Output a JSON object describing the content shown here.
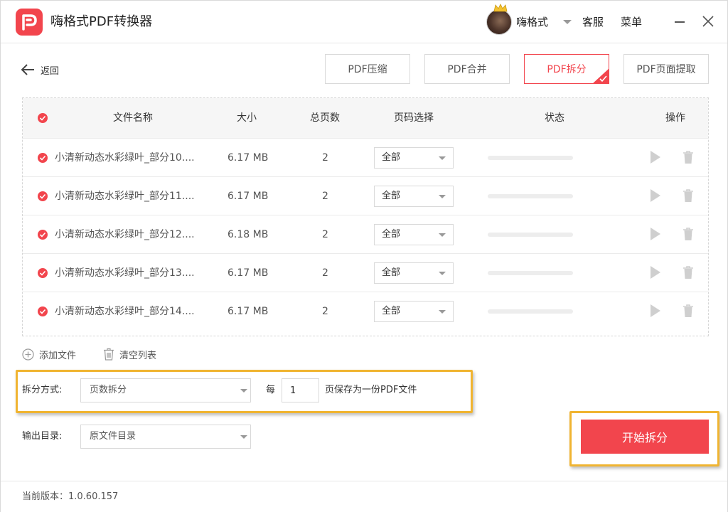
{
  "app": {
    "title": "嗨格式PDF转换器",
    "username": "嗨格式",
    "service": "客服",
    "menu": "菜单"
  },
  "nav": {
    "back_label": "返回",
    "tabs": [
      {
        "label": "PDF压缩",
        "active": false
      },
      {
        "label": "PDF合并",
        "active": false
      },
      {
        "label": "PDF拆分",
        "active": true
      },
      {
        "label": "PDF页面提取",
        "active": false
      }
    ]
  },
  "table": {
    "headers": {
      "name": "文件名称",
      "size": "大小",
      "pages": "总页数",
      "page_select": "页码选择",
      "status": "状态",
      "actions": "操作"
    },
    "rows": [
      {
        "name": "小清新动态水彩绿叶_部分10....",
        "size": "6.17 MB",
        "pages": "2",
        "page_select": "全部",
        "progress": 0
      },
      {
        "name": "小清新动态水彩绿叶_部分11....",
        "size": "6.17 MB",
        "pages": "2",
        "page_select": "全部",
        "progress": 0
      },
      {
        "name": "小清新动态水彩绿叶_部分12....",
        "size": "6.18 MB",
        "pages": "2",
        "page_select": "全部",
        "progress": 0
      },
      {
        "name": "小清新动态水彩绿叶_部分13....",
        "size": "6.17 MB",
        "pages": "2",
        "page_select": "全部",
        "progress": 0
      },
      {
        "name": "小清新动态水彩绿叶_部分14....",
        "size": "6.17 MB",
        "pages": "2",
        "page_select": "全部",
        "progress": 0
      }
    ]
  },
  "list_actions": {
    "add_file": "添加文件",
    "clear_list": "清空列表"
  },
  "split": {
    "mode_label": "拆分方式:",
    "mode_value": "页数拆分",
    "every_label": "每",
    "pages_value": "1",
    "suffix_label": "页保存为一份PDF文件"
  },
  "output": {
    "label": "输出目录:",
    "value": "原文件目录"
  },
  "start_button": "开始拆分",
  "footer": {
    "version": "当前版本：1.0.60.157"
  },
  "colors": {
    "accent": "#f2454d",
    "highlight": "#f0b431"
  }
}
